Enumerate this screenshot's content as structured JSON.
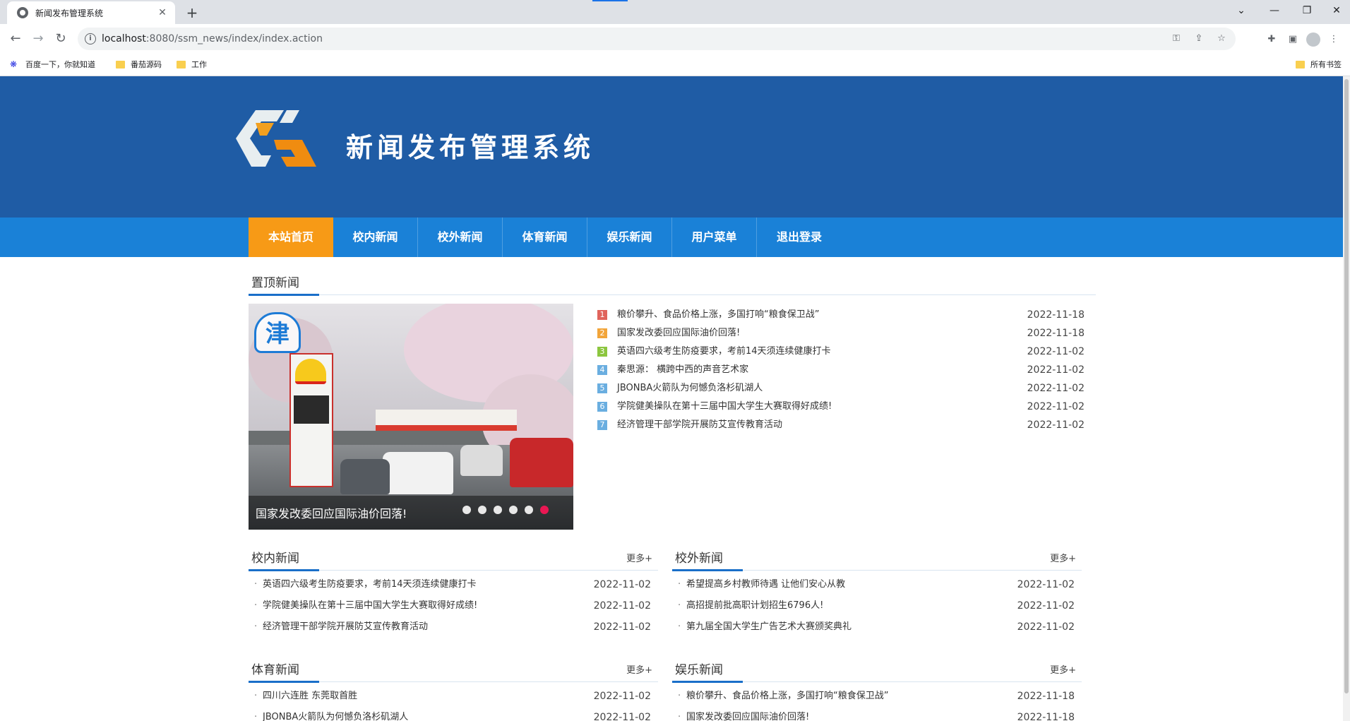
{
  "browser": {
    "tab_title": "新闻发布管理系统",
    "tab_close": "✕",
    "new_tab": "+",
    "url_host": "localhost",
    "url_rest": ":8080/ssm_news/index/index.action",
    "bookmarks": [
      {
        "label": "百度一下，你就知道"
      },
      {
        "label": "番茄源码"
      },
      {
        "label": "工作"
      }
    ],
    "other_bookmarks": "所有书签"
  },
  "site": {
    "title": "新闻发布管理系统",
    "nav": [
      {
        "label": "本站首页"
      },
      {
        "label": "校内新闻"
      },
      {
        "label": "校外新闻"
      },
      {
        "label": "体育新闻"
      },
      {
        "label": "娱乐新闻"
      },
      {
        "label": "用户菜单"
      },
      {
        "label": "退出登录"
      }
    ],
    "more_label": "更多+"
  },
  "colors": {
    "header_bg": "#1f5ca5",
    "nav_bg": "#1a81d7",
    "nav_active": "#f79a16",
    "accent": "#1a6fc9",
    "dot_active": "#ea1753"
  },
  "top_news": {
    "title": "置顶新闻",
    "slider_caption": "国家发改委回应国际油价回落!",
    "slider_dots": 6,
    "slider_active_dot": 6,
    "items": [
      {
        "num": "1",
        "color": "#e0645c",
        "title": "粮价攀升、食品价格上涨，多国打响“粮食保卫战”",
        "date": "2022-11-18"
      },
      {
        "num": "2",
        "color": "#f2a53a",
        "title": "国家发改委回应国际油价回落!",
        "date": "2022-11-18"
      },
      {
        "num": "3",
        "color": "#8cc63f",
        "title": "英语四六级考生防疫要求，考前14天须连续健康打卡",
        "date": "2022-11-02"
      },
      {
        "num": "4",
        "color": "#6aaee0",
        "title": "秦思源：  横跨中西的声音艺术家",
        "date": "2022-11-02"
      },
      {
        "num": "5",
        "color": "#6aaee0",
        "title": "JBONBA火箭队为何憾负洛杉矶湖人",
        "date": "2022-11-02"
      },
      {
        "num": "6",
        "color": "#6aaee0",
        "title": "学院健美操队在第十三届中国大学生大赛取得好成绩!",
        "date": "2022-11-02"
      },
      {
        "num": "7",
        "color": "#6aaee0",
        "title": "经济管理干部学院开展防艾宣传教育活动",
        "date": "2022-11-02"
      }
    ]
  },
  "campus_news": {
    "title": "校内新闻",
    "items": [
      {
        "title": "英语四六级考生防疫要求，考前14天须连续健康打卡",
        "date": "2022-11-02"
      },
      {
        "title": "学院健美操队在第十三届中国大学生大赛取得好成绩!",
        "date": "2022-11-02"
      },
      {
        "title": "经济管理干部学院开展防艾宣传教育活动",
        "date": "2022-11-02"
      }
    ]
  },
  "outside_news": {
    "title": "校外新闻",
    "items": [
      {
        "title": "希望提高乡村教师待遇 让他们安心从教",
        "date": "2022-11-02"
      },
      {
        "title": "高招提前批高职计划招生6796人!",
        "date": "2022-11-02"
      },
      {
        "title": "第九届全国大学生广告艺术大赛颁奖典礼",
        "date": "2022-11-02"
      }
    ]
  },
  "sports_news": {
    "title": "体育新闻",
    "items": [
      {
        "title": "四川六连胜 东莞取首胜",
        "date": "2022-11-02"
      },
      {
        "title": "JBONBA火箭队为何憾负洛杉矶湖人",
        "date": "2022-11-02"
      }
    ]
  },
  "ent_news": {
    "title": "娱乐新闻",
    "items": [
      {
        "title": "粮价攀升、食品价格上涨，多国打响“粮食保卫战”",
        "date": "2022-11-18"
      },
      {
        "title": "国家发改委回应国际油价回落!",
        "date": "2022-11-18"
      }
    ]
  }
}
